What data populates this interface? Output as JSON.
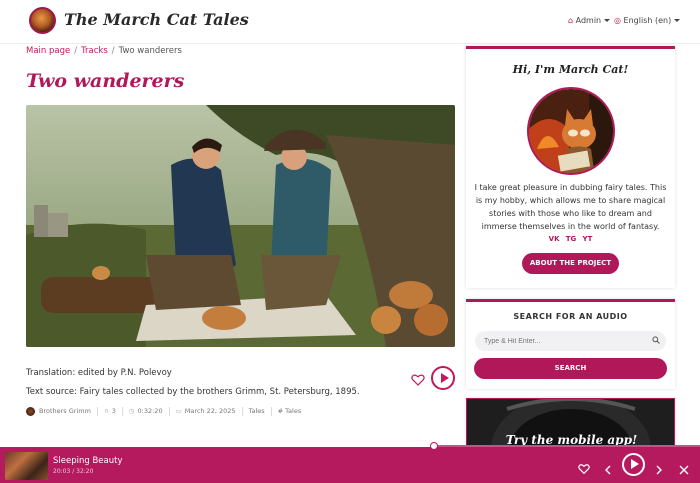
{
  "header": {
    "site_title": "The March Cat Tales",
    "user_menu": "Admin",
    "language_menu": "English (en)"
  },
  "breadcrumb": {
    "home": "Main page",
    "section": "Tracks",
    "current": "Two wanderers"
  },
  "track": {
    "title": "Two wanderers",
    "translation": "Translation: edited by P.N. Polevoy",
    "source": "Text source: Fairy tales collected by the brothers Grimm, St. Petersburg, 1895.",
    "author": "Brothers Grimm",
    "listens": "3",
    "duration": "0:32:20",
    "date": "March 22, 2025",
    "category": "Tales",
    "tag": "# Tales"
  },
  "sidebar": {
    "greeting": "Hi, I'm March Cat!",
    "about_text": "I take great pleasure in dubbing fairy tales. This is my hobby, which allows me to share magical stories with those who like to dream and immerse themselves in the world of fantasy.",
    "socials": [
      "VK",
      "TG",
      "YT"
    ],
    "about_button": "ABOUT THE PROJECT",
    "search_title": "SEARCH FOR AN AUDIO",
    "search_placeholder": "Type & Hit Enter...",
    "search_button": "SEARCH",
    "promo_text": "Try the mobile app!"
  },
  "player": {
    "title": "Sleeping Beauty",
    "time": "20:03 / 32:20",
    "progress": 0.62
  },
  "colors": {
    "accent": "#b0185a",
    "player_bg": "#b5195e"
  }
}
